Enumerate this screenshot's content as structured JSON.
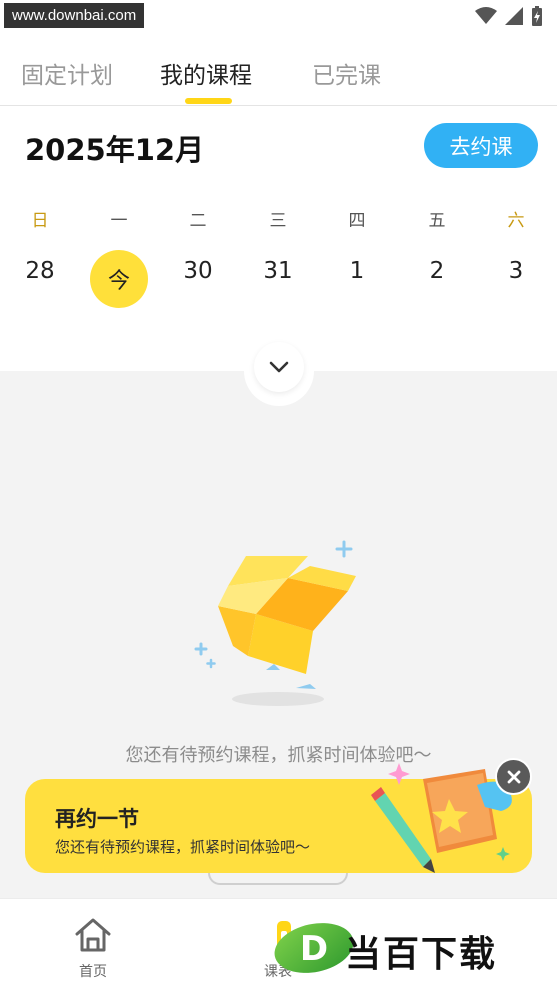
{
  "status_bar": {
    "watermark": "www.downbai.com"
  },
  "tabs": [
    {
      "label": "固定计划",
      "active": false
    },
    {
      "label": "我的课程",
      "active": true
    },
    {
      "label": "已完课",
      "active": false
    }
  ],
  "calendar": {
    "month_title": "2025年12月",
    "book_button": "去约课",
    "weekdays": [
      "日",
      "一",
      "二",
      "三",
      "四",
      "五",
      "六"
    ],
    "days": [
      "28",
      "今",
      "30",
      "31",
      "1",
      "2",
      "3"
    ]
  },
  "empty_state": {
    "message": "您还有待预约课程，抓紧时间体验吧～"
  },
  "banner": {
    "title": "再约一节",
    "subtitle": "您还有待预约课程，抓紧时间体验吧～"
  },
  "bottom_nav": {
    "home_label": "首页",
    "course_label": "课表"
  },
  "logo": {
    "text": "当百下载",
    "letter": "D"
  },
  "colors": {
    "accent_yellow": "#ffd617",
    "button_blue": "#31b1f4",
    "weekend_gold": "#c89a13",
    "content_gray": "#f3f3f3"
  }
}
